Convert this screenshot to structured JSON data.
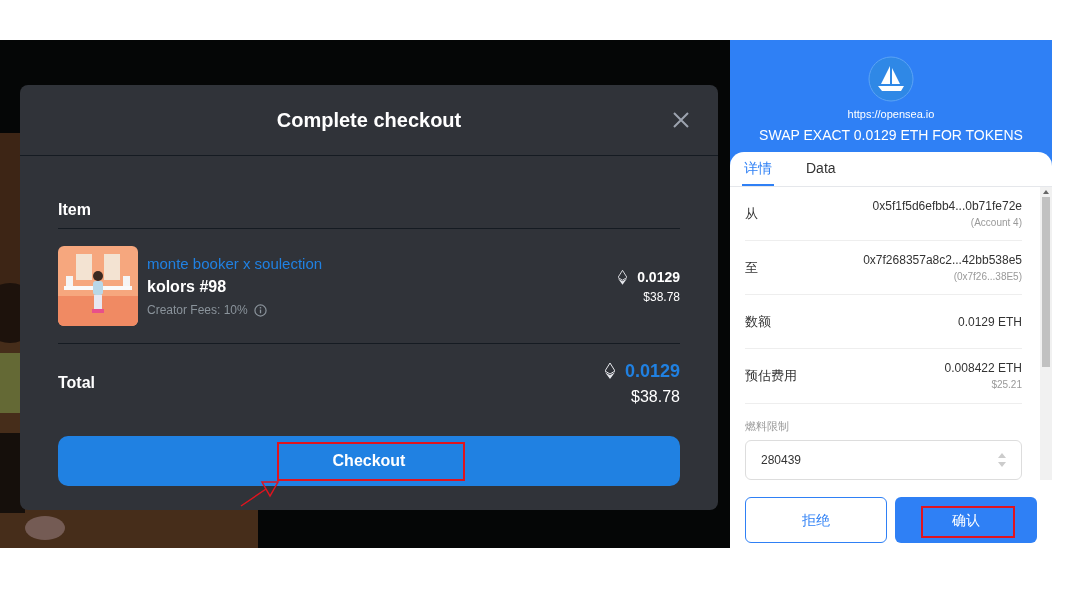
{
  "modal": {
    "title": "Complete checkout",
    "section_label": "Item",
    "item": {
      "collection": "monte booker x soulection",
      "name": "kolors #98",
      "fees": "Creator Fees: 10%",
      "price_eth": "0.0129",
      "price_usd": "$38.78"
    },
    "total": {
      "label": "Total",
      "eth": "0.0129",
      "usd": "$38.78"
    },
    "button": "Checkout"
  },
  "wallet": {
    "site": "https://opensea.io",
    "action": "SWAP EXACT 0.0129 ETH FOR TOKENS",
    "tabs": [
      {
        "label": "详情",
        "selected": true
      },
      {
        "label": "Data",
        "selected": false
      }
    ],
    "rows": [
      {
        "label": "从",
        "value": "0x5f1f5d6efbb4...0b71fe72e",
        "sub": "(Account 4)"
      },
      {
        "label": "至",
        "value": "0x7f268357a8c2...42bb538e5",
        "sub": "(0x7f26...38E5)"
      },
      {
        "label": "数额",
        "value": "0.0129 ETH"
      },
      {
        "label": "预估费用",
        "value": "0.008422 ETH",
        "sub": "$25.21"
      }
    ],
    "gas_label": "燃料限制",
    "gas_value": "280439",
    "buttons": [
      {
        "label": "拒绝",
        "kind": "secondary"
      },
      {
        "label": "确认",
        "kind": "primary"
      }
    ]
  }
}
